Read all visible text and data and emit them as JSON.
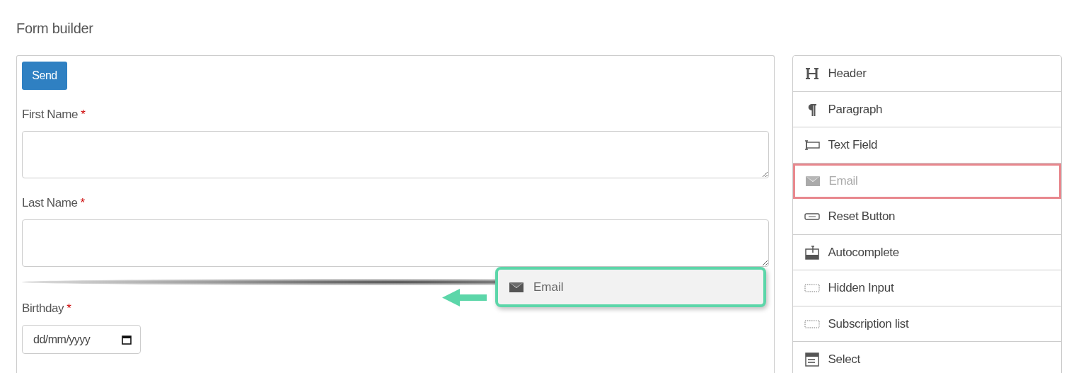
{
  "page": {
    "title": "Form builder"
  },
  "form": {
    "submit_button": "Send",
    "fields": [
      {
        "kind": "textarea",
        "label": "First Name",
        "required_mark": "*"
      },
      {
        "kind": "textarea",
        "label": "Last Name",
        "required_mark": "*"
      },
      {
        "kind": "drop-indicator"
      },
      {
        "kind": "date",
        "label": "Birthday",
        "required_mark": "*",
        "placeholder": "dd/mm/yyyy"
      }
    ]
  },
  "palette": [
    {
      "kind": "header",
      "label": "Header",
      "dragging": false
    },
    {
      "kind": "paragraph",
      "label": "Paragraph",
      "dragging": false
    },
    {
      "kind": "text",
      "label": "Text Field",
      "dragging": false
    },
    {
      "kind": "email",
      "label": "Email",
      "dragging": true
    },
    {
      "kind": "button",
      "label": "Reset Button",
      "dragging": false
    },
    {
      "kind": "autocomplete",
      "label": "Autocomplete",
      "dragging": false
    },
    {
      "kind": "hidden",
      "label": "Hidden Input",
      "dragging": false
    },
    {
      "kind": "hidden",
      "label": "Subscription list",
      "dragging": false
    },
    {
      "kind": "select",
      "label": "Select",
      "dragging": false
    }
  ],
  "drag_preview": {
    "kind": "email",
    "label": "Email"
  }
}
